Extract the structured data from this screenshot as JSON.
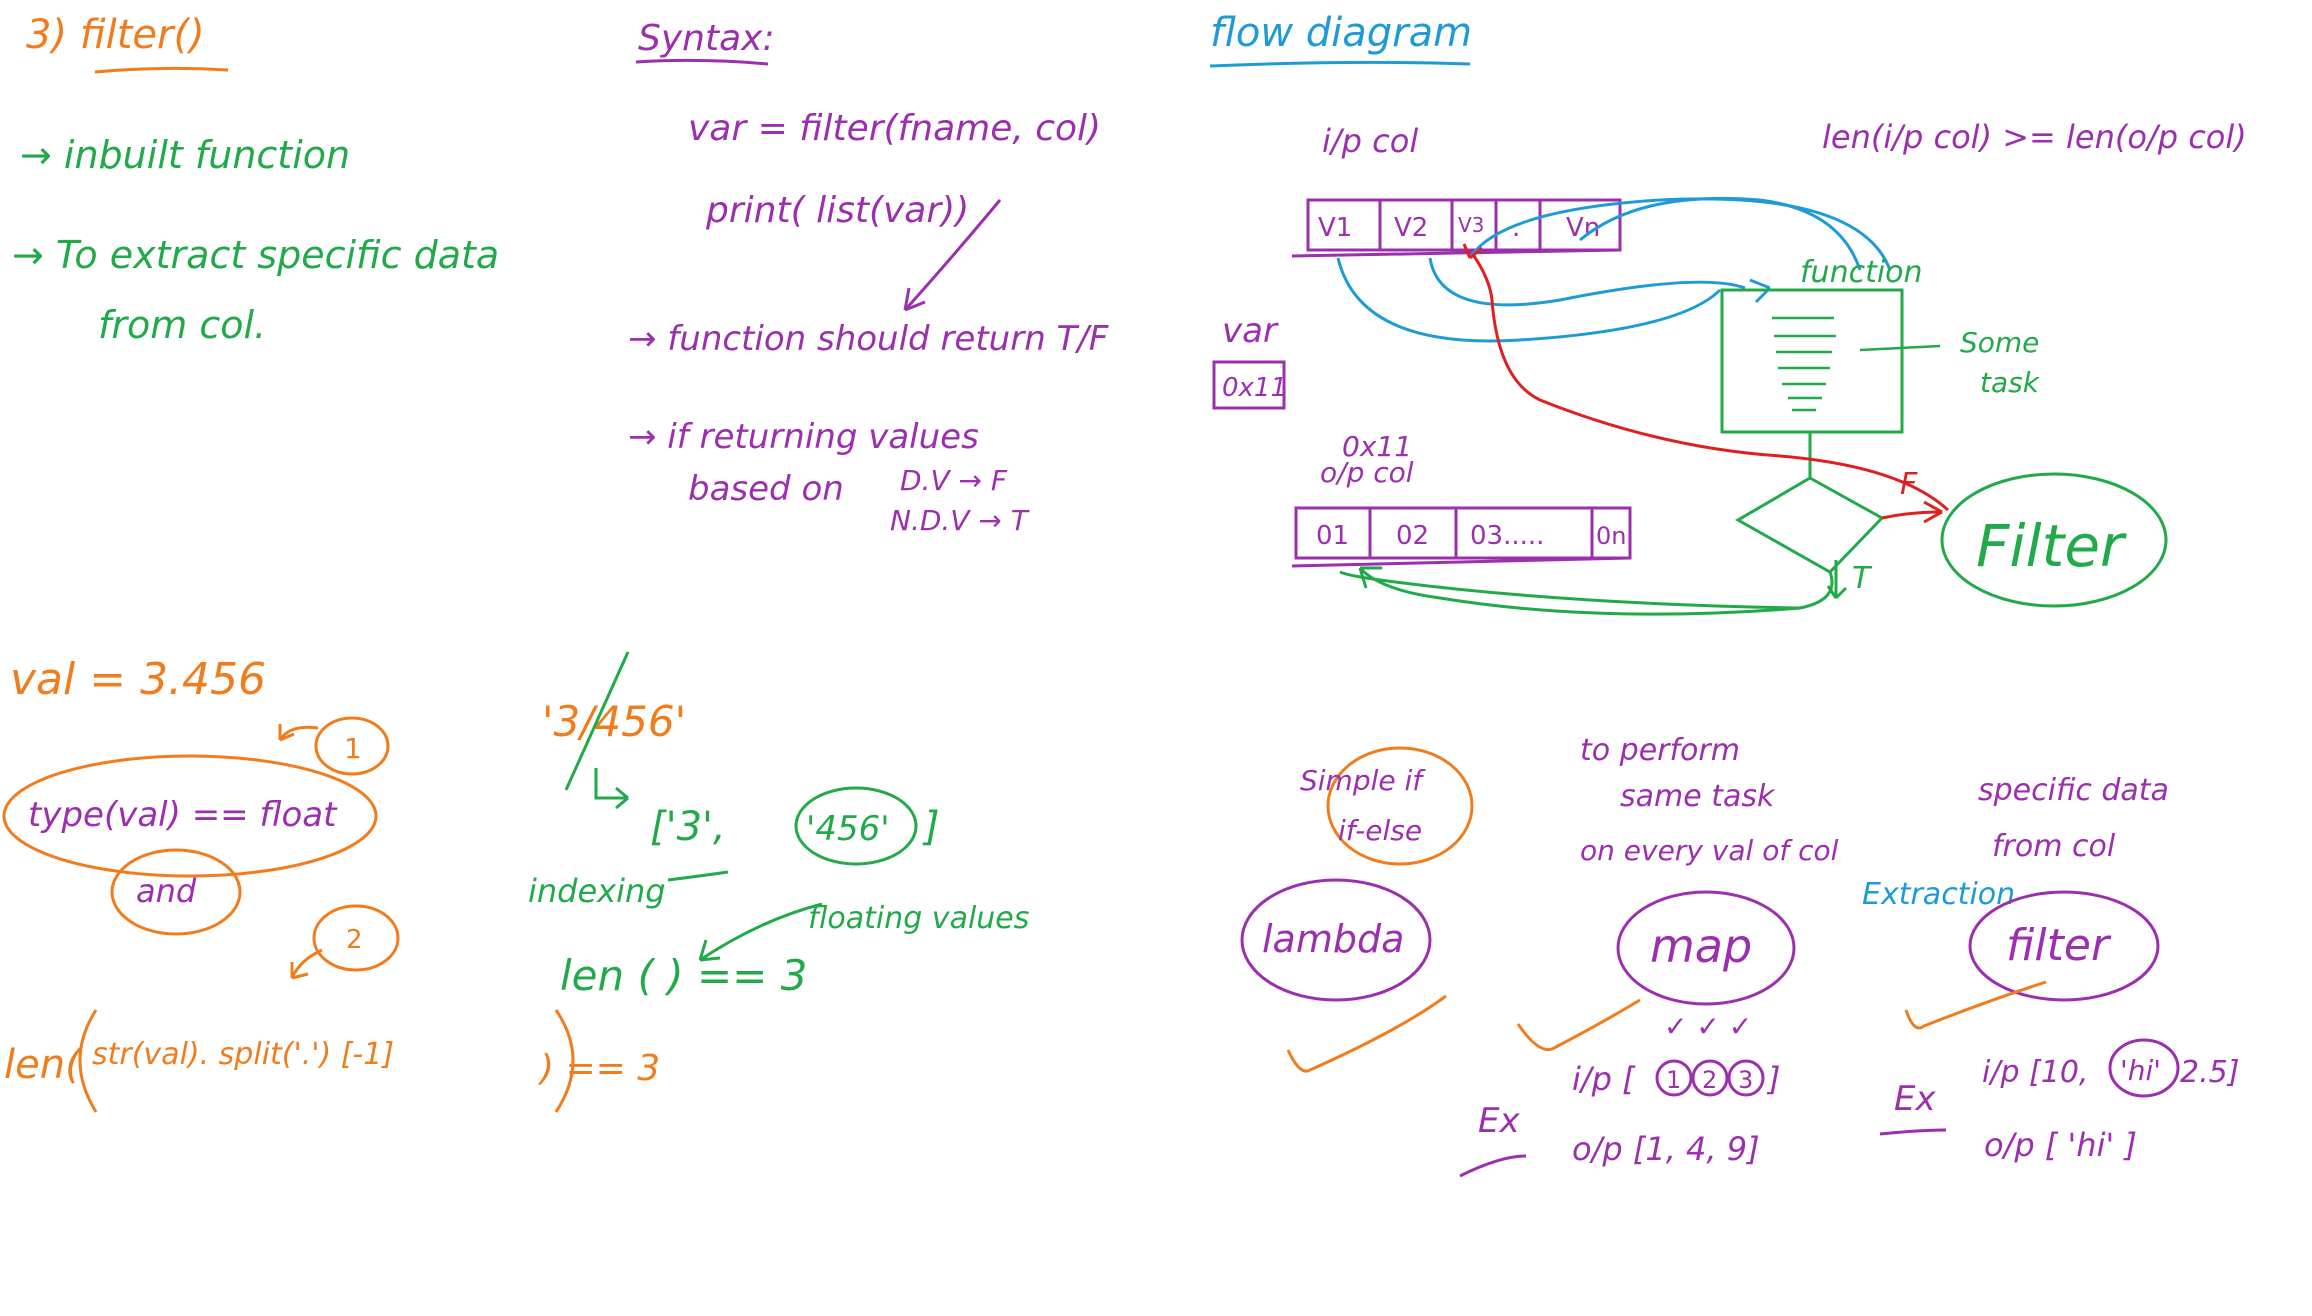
{
  "colors": {
    "orange": "#f07c1e",
    "green": "#22a94a",
    "purple": "#9b2fae",
    "blue": "#1e9bd7",
    "red": "#e02020"
  },
  "intro": {
    "heading": "3) filter()",
    "point1": "→ inbuilt function",
    "point2_a": "→ To extract specific data",
    "point2_b": "from col."
  },
  "syntax": {
    "heading": "Syntax:",
    "line1": "var = filter(fname, col)",
    "line2": "print( list(var))",
    "rule1": "→ function should return T/F",
    "var_label": "var",
    "var_box": "0x11",
    "rule2_a": "→ if returning values",
    "rule2_b": "based on",
    "rule2_dv": "D.V → F",
    "rule2_ndv": "N.D.V → T"
  },
  "flow": {
    "heading": "flow diagram",
    "ip_label": "i/p col",
    "ip_cells": [
      "V1",
      "V2",
      "V3",
      ".",
      "Vn"
    ],
    "len_rule": "len(i/p col) >= len(o/p col)",
    "function_label": "function",
    "task_label_a": "Some",
    "task_label_b": "task",
    "op_addr": "0x11",
    "op_label": "o/p col",
    "op_cells": [
      "01",
      "02",
      "03.....",
      "0n"
    ],
    "false_label": "F",
    "true_label": "T",
    "filter_label": "Filter"
  },
  "example": {
    "val_line": "val = 3.456",
    "cond1": "type(val) == float",
    "badge1": "1",
    "and_label": "and",
    "badge2": "2",
    "len_expr_a": "len(",
    "len_expr_b": "str(val). split('.') [-1]",
    "len_expr_c": ") == 3",
    "string_val": "'3/456'",
    "split_result_a": "['3',",
    "split_result_b": "'456'",
    "split_result_c": "]",
    "indexing_label": "indexing",
    "floating_label": "floating values",
    "len_check": "len (   ) == 3"
  },
  "compare": {
    "simple_a": "Simple if",
    "simple_b": "if-else",
    "lambda_label": "lambda",
    "map_note_a": "to perform",
    "map_note_b": "same task",
    "map_note_c": "on every val of col",
    "map_label": "map",
    "map_checks": "✓ ✓ ✓",
    "map_ex": "Ex",
    "map_ip_prefix": "i/p [",
    "map_ip_vals": [
      "1",
      "2",
      "3"
    ],
    "map_ip_suffix": "]",
    "map_op": "o/p [1, 4, 9]",
    "filter_note_a": "specific data",
    "filter_note_b": "from col",
    "extraction_label": "Extraction",
    "filter_label": "filter",
    "filter_ex": "Ex",
    "filter_ip_a": "i/p [10,",
    "filter_ip_hi": "'hi'",
    "filter_ip_b": "2.5]",
    "filter_op": "o/p [ 'hi' ]"
  }
}
